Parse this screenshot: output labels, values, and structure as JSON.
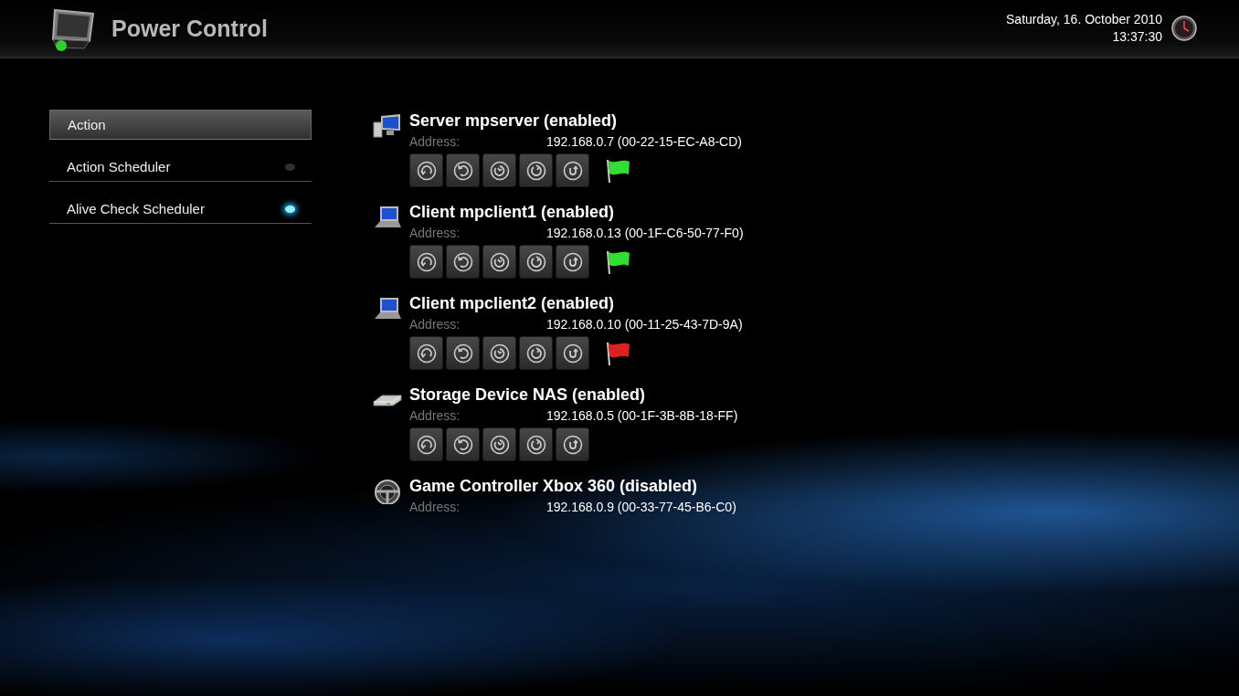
{
  "header": {
    "title": "Power Control",
    "date": "Saturday, 16. October 2010",
    "time": "13:37:30"
  },
  "sidebar": {
    "items": [
      {
        "label": "Action",
        "kind": "plain",
        "selected": true
      },
      {
        "label": "Action Scheduler",
        "kind": "scheduler",
        "selected": false,
        "active": false
      },
      {
        "label": "Alive Check Scheduler",
        "kind": "scheduler",
        "selected": false,
        "active": true
      }
    ]
  },
  "devices": [
    {
      "kind": "server",
      "name": "Server mpserver (enabled)",
      "address_label": "Address:",
      "address": "192.168.0.7 (00-22-15-EC-A8-CD)",
      "enabled": true,
      "status_flag": {
        "color": "#33dd33"
      }
    },
    {
      "kind": "laptop",
      "name": "Client mpclient1 (enabled)",
      "address_label": "Address:",
      "address": "192.168.0.13 (00-1F-C6-50-77-F0)",
      "enabled": true,
      "status_flag": {
        "color": "#33dd33"
      }
    },
    {
      "kind": "laptop",
      "name": "Client mpclient2 (enabled)",
      "address_label": "Address:",
      "address": "192.168.0.10 (00-11-25-43-7D-9A)",
      "enabled": true,
      "status_flag": {
        "color": "#e02020"
      }
    },
    {
      "kind": "storage",
      "name": "Storage Device NAS (enabled)",
      "address_label": "Address:",
      "address": "192.168.0.5 (00-1F-3B-8B-18-FF)",
      "enabled": true
    },
    {
      "kind": "wheel",
      "name": "Game Controller Xbox 360 (disabled)",
      "address_label": "Address:",
      "address": "192.168.0.9 (00-33-77-45-B6-C0)",
      "enabled": false
    }
  ]
}
